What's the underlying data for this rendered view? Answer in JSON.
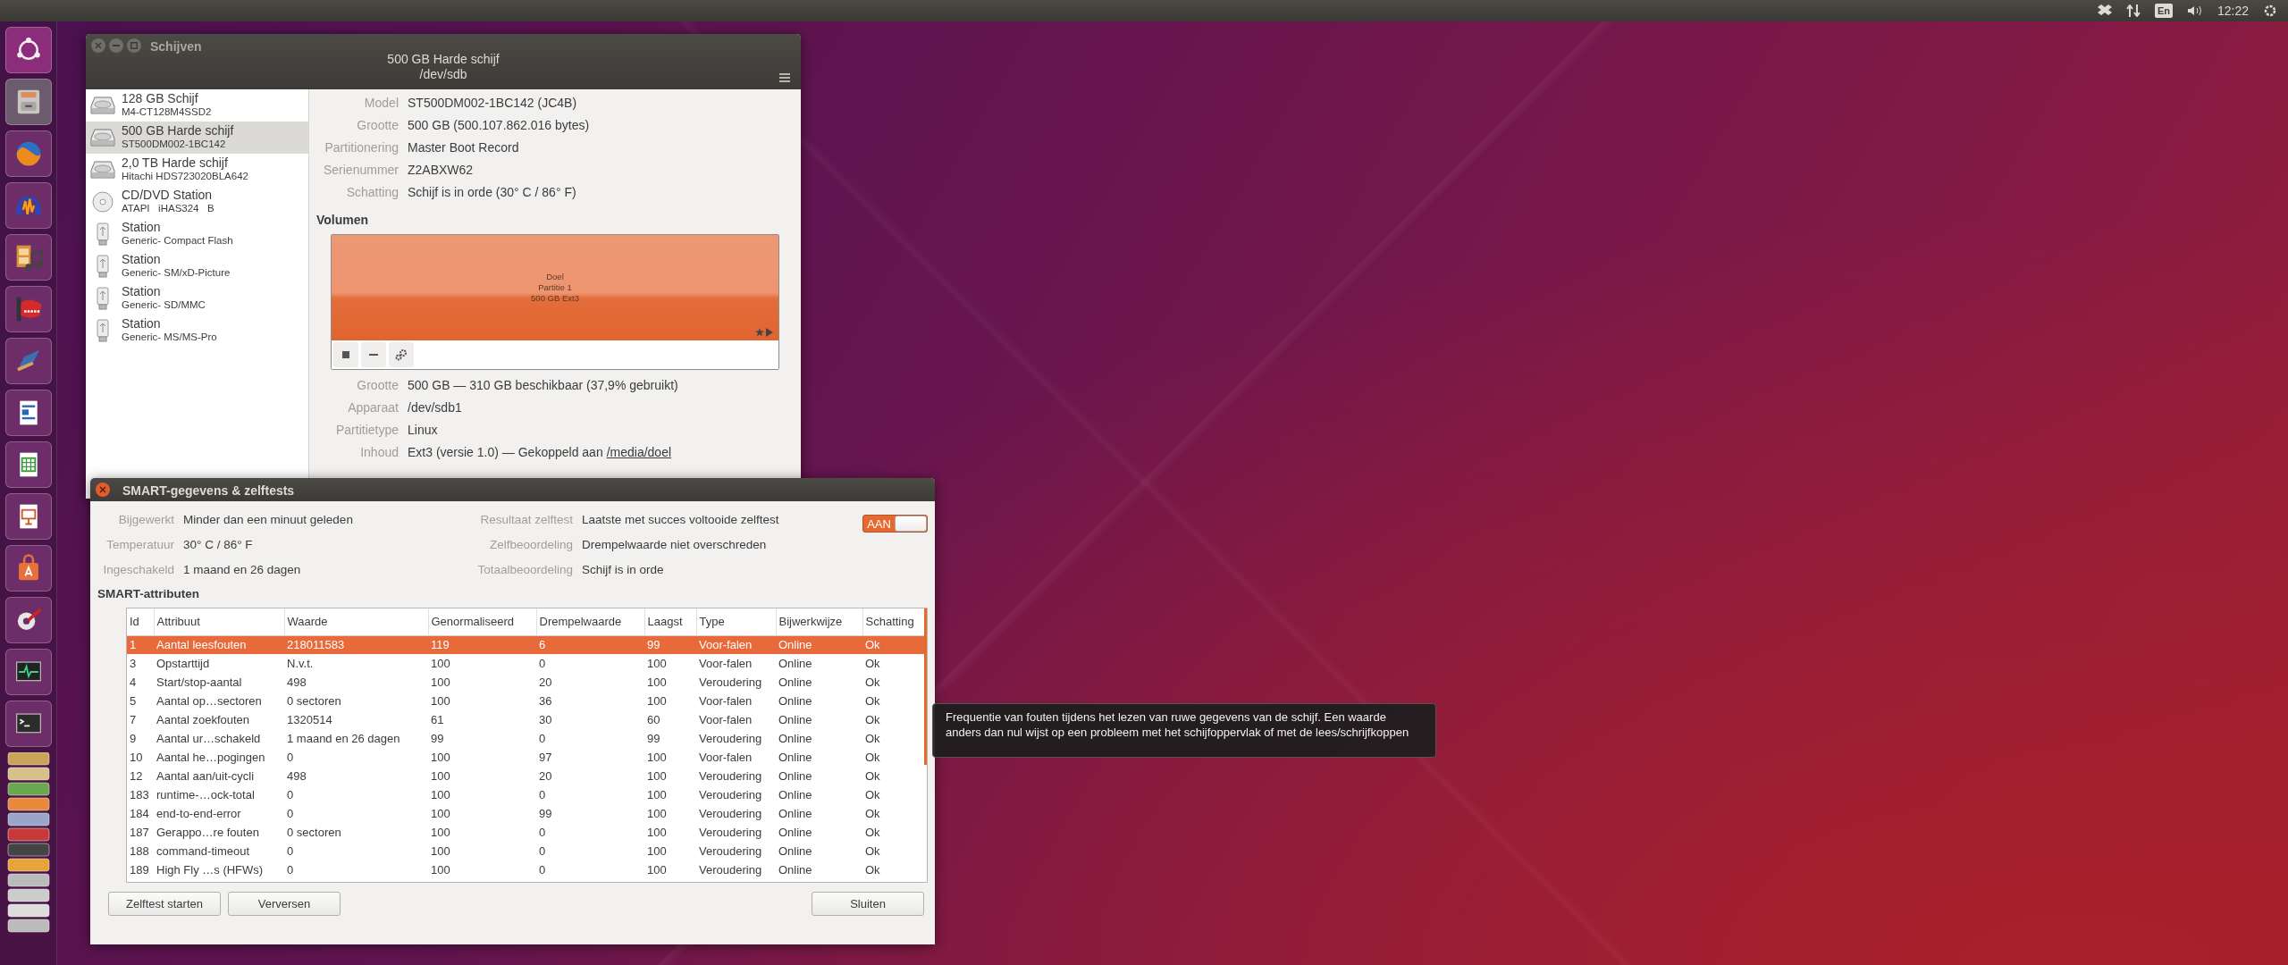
{
  "top_bar": {
    "keyboard_layout": "En",
    "clock": "12:22"
  },
  "disks_window": {
    "title": "Schijven",
    "header_title": "500 GB Harde schijf",
    "header_subtitle": "/dev/sdb",
    "drives": [
      {
        "kind": "hdd",
        "name": "128 GB Schijf",
        "model": "M4-CT128M4SSD2",
        "selected": false
      },
      {
        "kind": "hdd",
        "name": "500 GB Harde schijf",
        "model": "ST500DM002-1BC142",
        "selected": true
      },
      {
        "kind": "hdd",
        "name": "2,0 TB Harde schijf",
        "model": "Hitachi HDS723020BLA642",
        "selected": false
      },
      {
        "kind": "optical",
        "name": "CD/DVD Station",
        "model": "ATAPI   iHAS324   B",
        "selected": false
      },
      {
        "kind": "usb",
        "name": "Station",
        "model": "Generic- Compact Flash",
        "selected": false
      },
      {
        "kind": "usb",
        "name": "Station",
        "model": "Generic- SM/xD-Picture",
        "selected": false
      },
      {
        "kind": "usb",
        "name": "Station",
        "model": "Generic- SD/MMC",
        "selected": false
      },
      {
        "kind": "usb",
        "name": "Station",
        "model": "Generic- MS/MS-Pro",
        "selected": false
      }
    ],
    "drive_details": [
      {
        "label": "Model",
        "value": "ST500DM002-1BC142 (JC4B)"
      },
      {
        "label": "Grootte",
        "value": "500 GB (500.107.862.016 bytes)"
      },
      {
        "label": "Partitionering",
        "value": "Master Boot Record"
      },
      {
        "label": "Serienummer",
        "value": "Z2ABXW62"
      },
      {
        "label": "Schatting",
        "value": "Schijf is in orde (30° C / 86° F)"
      }
    ],
    "volumes_heading": "Volumen",
    "partition": {
      "lines": [
        "Doel",
        "Partitie 1",
        "500 GB Ext3"
      ],
      "selected": true
    },
    "volume_details": [
      {
        "label": "Grootte",
        "value": "500 GB — 310 GB beschikbaar (37,9% gebruikt)"
      },
      {
        "label": "Apparaat",
        "value": "/dev/sdb1"
      },
      {
        "label": "Partitietype",
        "value": "Linux"
      },
      {
        "label": "Inhoud",
        "value": "Ext3 (versie 1.0) — Gekoppeld aan",
        "link": "/media/doel"
      }
    ]
  },
  "smart_dialog": {
    "title": "SMART-gegevens & zelftests",
    "info_left": [
      {
        "label": "Bijgewerkt",
        "value": "Minder dan een minuut geleden"
      },
      {
        "label": "Temperatuur",
        "value": "30° C / 86° F"
      },
      {
        "label": "Ingeschakeld",
        "value": "1 maand en 26 dagen"
      }
    ],
    "info_right": [
      {
        "label": "Resultaat zelftest",
        "value": "Laatste met succes voltooide zelftest"
      },
      {
        "label": "Zelfbeoordeling",
        "value": "Drempelwaarde niet overschreden"
      },
      {
        "label": "Totaalbeoordeling",
        "value": "Schijf is in orde"
      }
    ],
    "switch": {
      "label": "AAN",
      "on": true
    },
    "attributes_heading": "SMART-attributen",
    "table": {
      "columns": [
        "Id",
        "Attribuut",
        "Waarde",
        "Genormaliseerd",
        "Drempelwaarde",
        "Laagst",
        "Type",
        "Bijwerkwijze",
        "Schatting"
      ],
      "rows": [
        {
          "selected": true,
          "cells": [
            "1",
            "Aantal leesfouten",
            "218011583",
            "119",
            "6",
            "99",
            "Voor-falen",
            "Online",
            "Ok"
          ]
        },
        {
          "selected": false,
          "cells": [
            "3",
            "Opstarttijd",
            "N.v.t.",
            "100",
            "0",
            "100",
            "Voor-falen",
            "Online",
            "Ok"
          ]
        },
        {
          "selected": false,
          "cells": [
            "4",
            "Start/stop-aantal",
            "498",
            "100",
            "20",
            "100",
            "Veroudering",
            "Online",
            "Ok"
          ]
        },
        {
          "selected": false,
          "cells": [
            "5",
            "Aantal op…sectoren",
            "0 sectoren",
            "100",
            "36",
            "100",
            "Voor-falen",
            "Online",
            "Ok"
          ]
        },
        {
          "selected": false,
          "cells": [
            "7",
            "Aantal zoekfouten",
            "1320514",
            "61",
            "30",
            "60",
            "Voor-falen",
            "Online",
            "Ok"
          ]
        },
        {
          "selected": false,
          "cells": [
            "9",
            "Aantal ur…schakeld",
            "1 maand en 26 dagen",
            "99",
            "0",
            "99",
            "Veroudering",
            "Online",
            "Ok"
          ]
        },
        {
          "selected": false,
          "cells": [
            "10",
            "Aantal he…pogingen",
            "0",
            "100",
            "97",
            "100",
            "Voor-falen",
            "Online",
            "Ok"
          ]
        },
        {
          "selected": false,
          "cells": [
            "12",
            "Aantal aan/uit-cycli",
            "498",
            "100",
            "20",
            "100",
            "Veroudering",
            "Online",
            "Ok"
          ]
        },
        {
          "selected": false,
          "cells": [
            "183",
            "runtime-…ock-total",
            "0",
            "100",
            "0",
            "100",
            "Veroudering",
            "Online",
            "Ok"
          ]
        },
        {
          "selected": false,
          "cells": [
            "184",
            "end-to-end-error",
            "0",
            "100",
            "99",
            "100",
            "Veroudering",
            "Online",
            "Ok"
          ]
        },
        {
          "selected": false,
          "cells": [
            "187",
            "Gerappo…re fouten",
            "0 sectoren",
            "100",
            "0",
            "100",
            "Veroudering",
            "Online",
            "Ok"
          ]
        },
        {
          "selected": false,
          "cells": [
            "188",
            "command-timeout",
            "0",
            "100",
            "0",
            "100",
            "Veroudering",
            "Online",
            "Ok"
          ]
        },
        {
          "selected": false,
          "cells": [
            "189",
            "High Fly …s (HFWs)",
            "0",
            "100",
            "0",
            "100",
            "Veroudering",
            "Online",
            "Ok"
          ]
        }
      ]
    },
    "buttons_left": [
      "Zelftest starten",
      "Verversen"
    ],
    "buttons_right": [
      "Sluiten"
    ]
  },
  "tooltip": {
    "text": "Frequentie van fouten tijdens het lezen van ruwe gegevens van de schijf. Een waarde anders dan nul wijst op een probleem met het schijfoppervlak of met de lees/schrijfkoppen"
  }
}
